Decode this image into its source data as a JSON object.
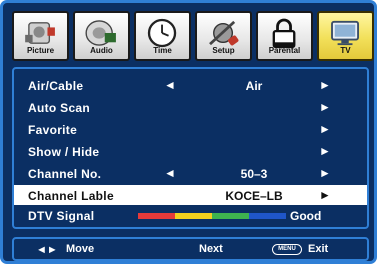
{
  "tabs": [
    {
      "label": "Picture",
      "icon": "picture-icon"
    },
    {
      "label": "Audio",
      "icon": "audio-icon"
    },
    {
      "label": "Time",
      "icon": "clock-icon"
    },
    {
      "label": "Setup",
      "icon": "tools-icon"
    },
    {
      "label": "Parental",
      "icon": "lock-icon"
    },
    {
      "label": "TV",
      "icon": "tv-icon",
      "active": true
    }
  ],
  "menu": {
    "air_cable": {
      "label": "Air/Cable",
      "value": "Air"
    },
    "auto_scan": {
      "label": "Auto Scan"
    },
    "favorite": {
      "label": "Favorite"
    },
    "show_hide": {
      "label": "Show / Hide"
    },
    "channel_no": {
      "label": "Channel No.",
      "value": "50–3"
    },
    "channel_lable": {
      "label": "Channel Lable",
      "value": "KOCE–LB"
    },
    "dtv_signal": {
      "label": "DTV Signal",
      "value": "Good",
      "bar_colors": [
        "#e53a3a",
        "#f2d01e",
        "#3fb34f",
        "#1f56c9"
      ]
    }
  },
  "arrows": {
    "left": "◄",
    "right": "►"
  },
  "footer": {
    "move_icon": "◄►",
    "move_label": "Move",
    "next_label": "Next",
    "menu_key": "MENU",
    "exit_label": "Exit"
  },
  "colors": {
    "panel": "#0b2f63",
    "border": "#2f7fd6",
    "active_tab": "#f2e05a",
    "selected_row": "#ffffff"
  }
}
